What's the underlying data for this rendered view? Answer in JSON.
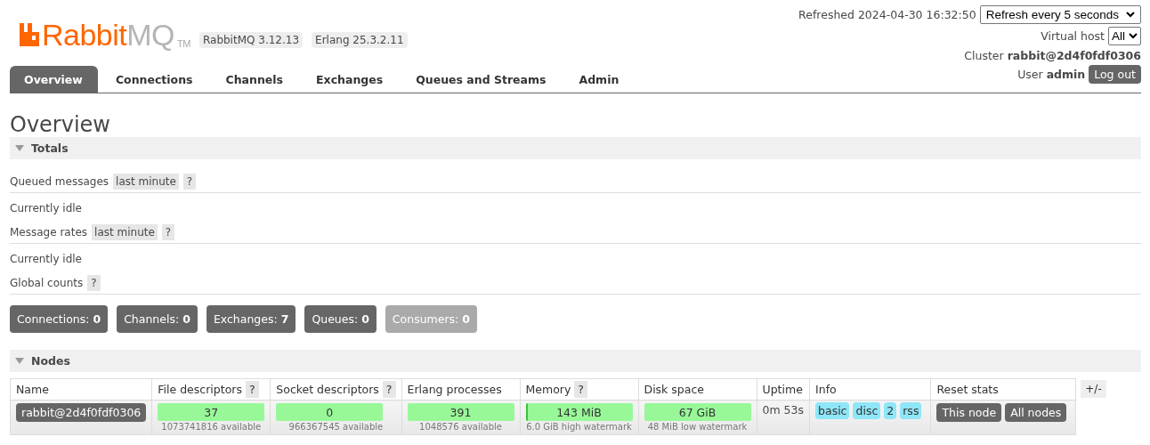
{
  "logo": {
    "brand": "Rabbit",
    "suffix": "MQ",
    "trademark": "TM"
  },
  "versions": [
    "RabbitMQ 3.12.13",
    "Erlang 25.3.2.11"
  ],
  "refresh": {
    "label": "Refreshed 2024-04-30 16:32:50",
    "value": "Refresh every 5 seconds"
  },
  "vhost": {
    "label": "Virtual host",
    "value": "All"
  },
  "cluster": {
    "label": "Cluster",
    "value": "rabbit@2d4f0fdf0306"
  },
  "user": {
    "label": "User",
    "value": "admin",
    "button": "Log out"
  },
  "tabs": [
    {
      "label": "Overview",
      "selected": true
    },
    {
      "label": "Connections",
      "selected": false
    },
    {
      "label": "Channels",
      "selected": false
    },
    {
      "label": "Exchanges",
      "selected": false
    },
    {
      "label": "Queues and Streams",
      "selected": false
    },
    {
      "label": "Admin",
      "selected": false
    }
  ],
  "title": "Overview",
  "totals": {
    "title": "Totals",
    "expanded": true,
    "groups": [
      {
        "label": "Queued messages",
        "range": "last minute",
        "help": "?",
        "status": "Currently idle"
      },
      {
        "label": "Message rates",
        "range": "last minute",
        "help": "?",
        "status": "Currently idle"
      },
      {
        "label": "Global counts",
        "help": "?"
      }
    ],
    "counts": [
      {
        "label": "Connections:",
        "value": "0",
        "disabled": false
      },
      {
        "label": "Channels:",
        "value": "0",
        "disabled": false
      },
      {
        "label": "Exchanges:",
        "value": "7",
        "disabled": false
      },
      {
        "label": "Queues:",
        "value": "0",
        "disabled": false
      },
      {
        "label": "Consumers:",
        "value": "0",
        "disabled": true
      }
    ]
  },
  "nodes": {
    "title": "Nodes",
    "expanded": true,
    "toggle": "+/-",
    "columns": [
      {
        "label": "Name"
      },
      {
        "label": "File descriptors",
        "help": "?"
      },
      {
        "label": "Socket descriptors",
        "help": "?"
      },
      {
        "label": "Erlang processes"
      },
      {
        "label": "Memory",
        "help": "?"
      },
      {
        "label": "Disk space"
      },
      {
        "label": "Uptime"
      },
      {
        "label": "Info"
      },
      {
        "label": "Reset stats"
      }
    ],
    "rows": [
      {
        "cells": [
          {
            "kind": "name",
            "text": "rabbit@2d4f0fdf0306"
          },
          {
            "kind": "meter",
            "value": "37",
            "sub": "1073741816 available"
          },
          {
            "kind": "meter",
            "value": "0",
            "sub": "966367545 available"
          },
          {
            "kind": "meter",
            "value": "391",
            "sub": "1048576 available"
          },
          {
            "kind": "meter",
            "value": "143 MiB",
            "sub": "6.0 GiB high watermark",
            "level": 0.02
          },
          {
            "kind": "meter",
            "value": "67 GiB",
            "sub": "48 MiB low watermark"
          },
          {
            "kind": "text",
            "text": "0m 53s"
          },
          {
            "kind": "tags",
            "items": [
              "basic",
              "disc",
              "2",
              "rss"
            ]
          },
          {
            "kind": "buttons",
            "items": [
              "This node",
              "All nodes"
            ]
          }
        ]
      }
    ]
  }
}
